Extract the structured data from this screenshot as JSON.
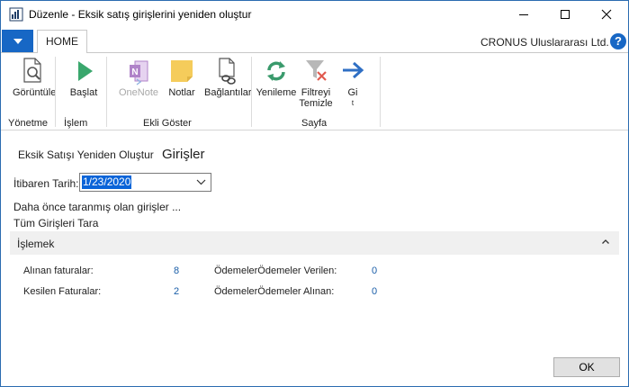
{
  "window": {
    "title": "Düzenle - Eksik satış girişlerini yeniden oluştur"
  },
  "tabs": {
    "home": "HOME"
  },
  "company": "CRONUS Uluslararası Ltd.",
  "help": "?",
  "ribbon": {
    "groups": {
      "manage": "Yönetme",
      "process": "İşlem",
      "show_attached": "Ekli Göster",
      "page": "Sayfa"
    },
    "buttons": {
      "view": "Görüntüle",
      "start": "Başlat",
      "onenote": "OneNote",
      "notes": "Notlar",
      "links": "Bağlantılar",
      "refresh": "Yenileme",
      "clear_filter_1": "Filtreyi",
      "clear_filter_2": "Temizle",
      "goto_1": "Gi",
      "goto_2": "t"
    }
  },
  "breadcrumb": {
    "action": "Eksik Satışı Yeniden Oluştur",
    "page": "Girişler"
  },
  "form": {
    "start_date_label": "İtibaren Tarih:",
    "start_date_value": "1/23/2020",
    "scanned_label": "Daha önce taranmış olan girişler ...",
    "scan_all": "Tüm Girişleri Tara"
  },
  "section": {
    "title": "İşlemek",
    "stats": {
      "invoices_received_label": "Alınan faturalar:",
      "invoices_received_value": "8",
      "invoices_issued_label": "Kesilen Faturalar:",
      "invoices_issued_value": "2",
      "payments_given_label": "ÖdemelerÖdemeler Verilen:",
      "payments_given_value": "0",
      "payments_received_label": "ÖdemelerÖdemeler Alınan:",
      "payments_received_value": "0"
    }
  },
  "footer": {
    "ok": "OK"
  },
  "colors": {
    "accent": "#1767c5",
    "link": "#1a5ea8",
    "refresh_green": "#3a9a6c",
    "start_green": "#3aa76d",
    "onenote_purple": "#b083c9",
    "notes_yellow": "#f5cc5b"
  }
}
